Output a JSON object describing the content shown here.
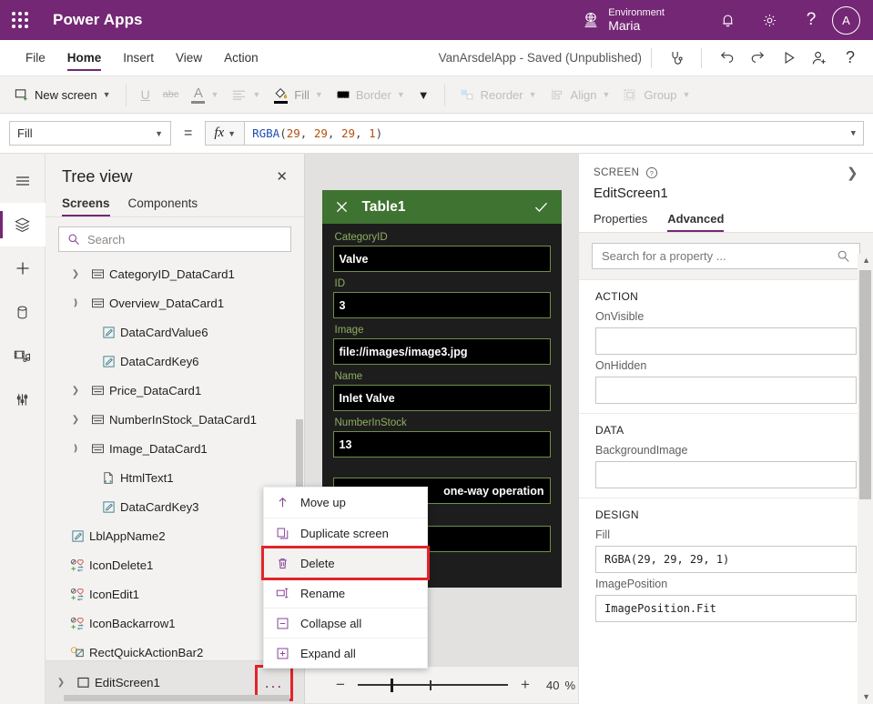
{
  "topbar": {
    "waffle_icon": "app-launcher-icon",
    "brand": "Power Apps",
    "environment_label": "Environment",
    "environment_name": "Maria",
    "globe_icon": "environment-globe-icon",
    "bell_icon": "notifications-icon",
    "gear_icon": "settings-icon",
    "help_icon": "help-icon",
    "avatar_initial": "A",
    "purple": "#742774"
  },
  "menubar": {
    "items": [
      {
        "label": "File",
        "active": false
      },
      {
        "label": "Home",
        "active": true
      },
      {
        "label": "Insert",
        "active": false
      },
      {
        "label": "View",
        "active": false
      },
      {
        "label": "Action",
        "active": false
      }
    ],
    "app_title": "VanArsdelApp - Saved (Unpublished)",
    "icons": [
      "app-checker-icon",
      "undo-icon",
      "redo-icon",
      "preview-play-icon",
      "share-icon",
      "help-icon"
    ]
  },
  "ribbon": {
    "new_screen": "New screen",
    "underline": "U",
    "strikethrough": "abc",
    "font_color": "A",
    "align": "align-icon",
    "fill": "Fill",
    "border": "Border",
    "more": "chevron-down-icon",
    "reorder": "Reorder",
    "align_group": "Align",
    "group": "Group"
  },
  "formulabar": {
    "property": "Fill",
    "equals": "=",
    "fx": "fx",
    "formula_fn": "RGBA",
    "formula_args": [
      "29",
      "29",
      "29",
      "1"
    ],
    "formula_full": "RGBA(29, 29, 29, 1)"
  },
  "rail": {
    "items": [
      {
        "name": "hamburger-menu-icon",
        "selected": false
      },
      {
        "name": "tree-view-layers-icon",
        "selected": true
      },
      {
        "name": "insert-plus-icon",
        "selected": false
      },
      {
        "name": "data-sources-icon",
        "selected": false
      },
      {
        "name": "media-icon",
        "selected": false
      },
      {
        "name": "advanced-tools-icon",
        "selected": false
      }
    ]
  },
  "treeview": {
    "title": "Tree view",
    "close_icon": "close-icon",
    "tabs": [
      {
        "label": "Screens",
        "active": true
      },
      {
        "label": "Components",
        "active": false
      }
    ],
    "search_placeholder": "Search",
    "search_icon": "search-icon",
    "nodes": [
      {
        "label": "CategoryID_DataCard1",
        "level": 1,
        "twisty": "collapsed",
        "icon": "datacard-icon"
      },
      {
        "label": "Overview_DataCard1",
        "level": 1,
        "twisty": "expanded",
        "icon": "datacard-icon"
      },
      {
        "label": "DataCardValue6",
        "level": 2,
        "twisty": "none",
        "icon": "textinput-icon"
      },
      {
        "label": "DataCardKey6",
        "level": 2,
        "twisty": "none",
        "icon": "textinput-icon"
      },
      {
        "label": "Price_DataCard1",
        "level": 1,
        "twisty": "collapsed",
        "icon": "datacard-icon"
      },
      {
        "label": "NumberInStock_DataCard1",
        "level": 1,
        "twisty": "collapsed",
        "icon": "datacard-icon"
      },
      {
        "label": "Image_DataCard1",
        "level": 1,
        "twisty": "expanded",
        "icon": "datacard-icon"
      },
      {
        "label": "HtmlText1",
        "level": 2,
        "twisty": "none",
        "icon": "htmltext-icon"
      },
      {
        "label": "DataCardKey3",
        "level": 2,
        "twisty": "none",
        "icon": "textinput-icon"
      },
      {
        "label": "LblAppName2",
        "level": 1,
        "twisty": "none",
        "icon": "label-icon"
      },
      {
        "label": "IconDelete1",
        "level": 1,
        "twisty": "none",
        "icon": "icon-control-icon"
      },
      {
        "label": "IconEdit1",
        "level": 1,
        "twisty": "none",
        "icon": "icon-control-icon"
      },
      {
        "label": "IconBackarrow1",
        "level": 1,
        "twisty": "none",
        "icon": "icon-control-icon"
      },
      {
        "label": "RectQuickActionBar2",
        "level": 1,
        "twisty": "none",
        "icon": "shape-icon"
      }
    ],
    "selected_screen": {
      "label": "EditScreen1",
      "twisty": "collapsed",
      "icon": "screen-icon",
      "ellipsis": "...",
      "ellipsis_highlighted": true
    }
  },
  "context_menu": {
    "items": [
      {
        "label": "Move up",
        "icon": "arrow-up-icon",
        "highlighted": false
      },
      {
        "label": "Duplicate screen",
        "icon": "copy-icon",
        "highlighted": false
      },
      {
        "label": "Delete",
        "icon": "trash-icon",
        "highlighted": true
      },
      {
        "label": "Rename",
        "icon": "rename-icon",
        "highlighted": false
      },
      {
        "label": "Collapse all",
        "icon": "collapse-all-icon",
        "highlighted": false
      },
      {
        "label": "Expand all",
        "icon": "expand-all-icon",
        "highlighted": false
      }
    ],
    "highlight_color": "#e3242b"
  },
  "canvas": {
    "form": {
      "header_title": "Table1",
      "close_icon": "close-icon",
      "check_icon": "checkmark-icon",
      "header_color": "#3f7331",
      "background": "#1d1d1d",
      "fields": [
        {
          "label": "CategoryID",
          "value": "Valve"
        },
        {
          "label": "ID",
          "value": "3"
        },
        {
          "label": "Image",
          "value": "file://images/image3.jpg"
        },
        {
          "label": "Name",
          "value": "Inlet Valve"
        },
        {
          "label": "NumberInStock",
          "value": "13"
        },
        {
          "label": "",
          "value": "one-way operation"
        },
        {
          "label": "",
          "value": ""
        }
      ]
    },
    "scroll_arrow": "scroll-right-arrow-icon"
  },
  "statusbar": {
    "zoom_out": "−",
    "zoom_in": "+",
    "zoom_value": "40",
    "zoom_unit": "%"
  },
  "properties": {
    "kicker": "SCREEN",
    "help_icon": "help-circle-icon",
    "collapse_icon": "chevron-right-icon",
    "name": "EditScreen1",
    "tabs": [
      {
        "label": "Properties",
        "active": false
      },
      {
        "label": "Advanced",
        "active": true
      }
    ],
    "search_placeholder": "Search for a property ...",
    "search_icon": "search-icon",
    "sections": [
      {
        "title": "ACTION",
        "fields": [
          {
            "label": "OnVisible",
            "value": ""
          },
          {
            "label": "OnHidden",
            "value": ""
          }
        ]
      },
      {
        "title": "DATA",
        "fields": [
          {
            "label": "BackgroundImage",
            "value": ""
          }
        ]
      },
      {
        "title": "DESIGN",
        "fields": [
          {
            "label": "Fill",
            "value": "RGBA(29, 29, 29, 1)"
          },
          {
            "label": "ImagePosition",
            "value": "ImagePosition.Fit"
          }
        ]
      }
    ]
  }
}
